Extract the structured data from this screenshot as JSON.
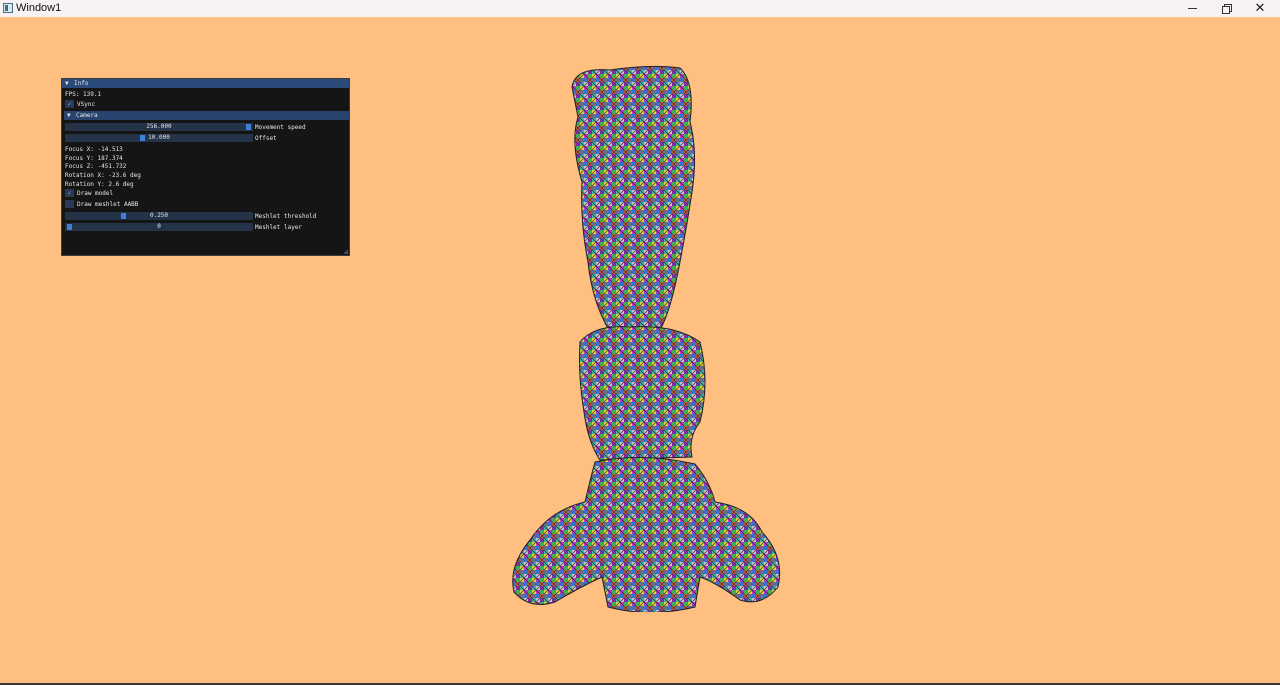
{
  "window": {
    "title": "Window1"
  },
  "panel": {
    "title": "Info",
    "fps": "FPS: 139.1",
    "vsync_label": "VSync",
    "vsync_checked": true,
    "camera_section": "Camera",
    "movement_speed": {
      "value": "256.000",
      "label": "Movement speed"
    },
    "offset": {
      "value": "10.000",
      "label": "Offset"
    },
    "focus_x": "Focus X: -14.513",
    "focus_y": "Focus Y: 187.374",
    "focus_z": "Focus Z: -451.732",
    "rotation_x": "Rotation X: -23.6 deg",
    "rotation_y": "Rotation Y: 2.6 deg",
    "draw_model": {
      "label": "Draw model",
      "checked": true
    },
    "draw_aabb": {
      "label": "Draw meshlet AABB",
      "checked": false
    },
    "meshlet_threshold": {
      "value": "0.250",
      "label": "Meshlet threshold"
    },
    "meshlet_layer": {
      "value": "0",
      "label": "Meshlet layer"
    }
  },
  "colors": {
    "background": "#ffbf80",
    "panel_bg": "#151515",
    "panel_title": "#2a4a7a",
    "accent": "#3d80d8"
  },
  "icons": {
    "collapse": "triangle-down-icon",
    "check": "checkmark-icon",
    "minimize": "minimize-icon",
    "maximize": "restore-icon",
    "close": "close-icon"
  }
}
